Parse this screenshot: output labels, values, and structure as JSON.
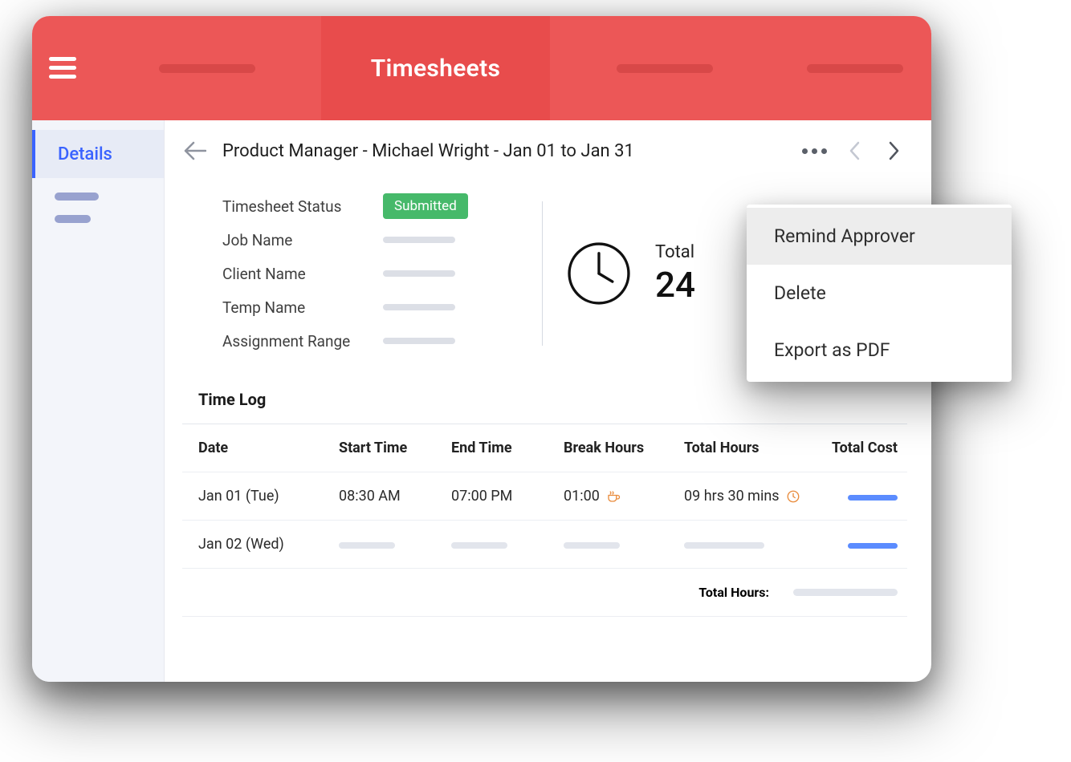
{
  "header": {
    "title": "Timesheets"
  },
  "sidebar": {
    "active_label": "Details"
  },
  "record": {
    "role": "Product Manager",
    "name": "Michael Wright",
    "range": "Jan 01 to Jan 31",
    "title_full": "Product Manager - Michael Wright - Jan 01 to Jan 31"
  },
  "info": {
    "labels": {
      "status": "Timesheet Status",
      "job": "Job Name",
      "client": "Client Name",
      "temp": "Temp Name",
      "range": "Assignment Range"
    },
    "status_value": "Submitted",
    "total_label": "Total",
    "total_value": "24"
  },
  "timelog": {
    "section_title": "Time Log",
    "columns": {
      "date": "Date",
      "start": "Start Time",
      "end": "End Time",
      "break": "Break Hours",
      "total": "Total Hours",
      "cost": "Total Cost"
    },
    "rows": [
      {
        "date": "Jan 01 (Tue)",
        "start": "08:30 AM",
        "end": "07:00 PM",
        "break": "01:00",
        "total": "09 hrs 30 mins"
      },
      {
        "date": "Jan 02 (Wed)",
        "start": "",
        "end": "",
        "break": "",
        "total": ""
      }
    ],
    "footer_label": "Total Hours:"
  },
  "menu": {
    "items": [
      {
        "label": "Remind Approver",
        "highlighted": true
      },
      {
        "label": "Delete",
        "highlighted": false
      },
      {
        "label": "Export as PDF",
        "highlighted": false
      }
    ]
  },
  "icons": {
    "hamburger": "hamburger-icon",
    "back": "arrow-left-icon",
    "more": "more-horiz-icon",
    "prev": "chevron-left-icon",
    "next": "chevron-right-icon",
    "clock": "clock-icon",
    "coffee": "coffee-icon",
    "overtime": "overtime-clock-icon"
  }
}
